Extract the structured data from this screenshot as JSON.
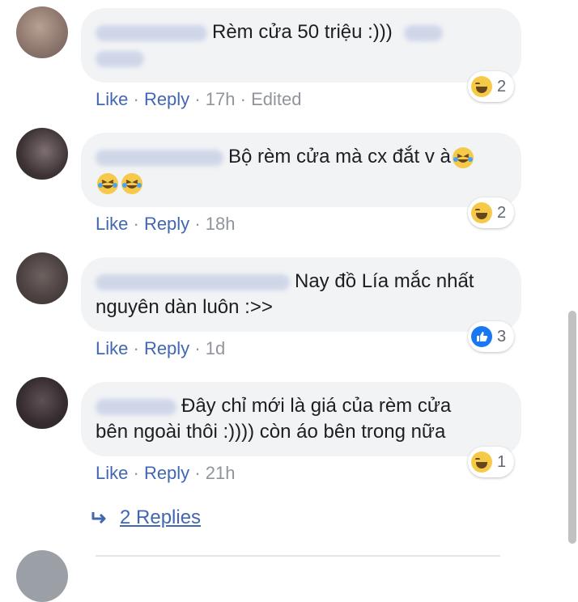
{
  "comments": [
    {
      "text": "Rèm cửa 50 triệu :)))",
      "like": "Like",
      "reply": "Reply",
      "time": "17h",
      "edited": "Edited",
      "reaction_icon": "laugh-icon",
      "reaction_count": "2"
    },
    {
      "text": "Bộ rèm cửa mà cx đắt v à",
      "like": "Like",
      "reply": "Reply",
      "time": "18h",
      "reaction_icon": "laugh-icon",
      "reaction_count": "2"
    },
    {
      "text_line1": "Nay đồ Lía mắc nhất",
      "text_line2": "nguyên dàn luôn :>>",
      "like": "Like",
      "reply": "Reply",
      "time": "1d",
      "reaction_icon": "like-icon",
      "reaction_count": "3"
    },
    {
      "text_line1": "Đây chỉ mới là giá của rèm cửa",
      "text_line2": "bên ngoài thôi :)))) còn áo bên trong nữa",
      "like": "Like",
      "reply": "Reply",
      "time": "21h",
      "reaction_icon": "laugh-icon",
      "reaction_count": "1"
    }
  ],
  "replies_link": "2 Replies",
  "separator": "·",
  "colors": {
    "link": "#4267b2",
    "bubble": "#f2f3f5",
    "meta": "#90949c",
    "like_blue": "#1877f2",
    "emoji_yellow": "#f7c948"
  }
}
